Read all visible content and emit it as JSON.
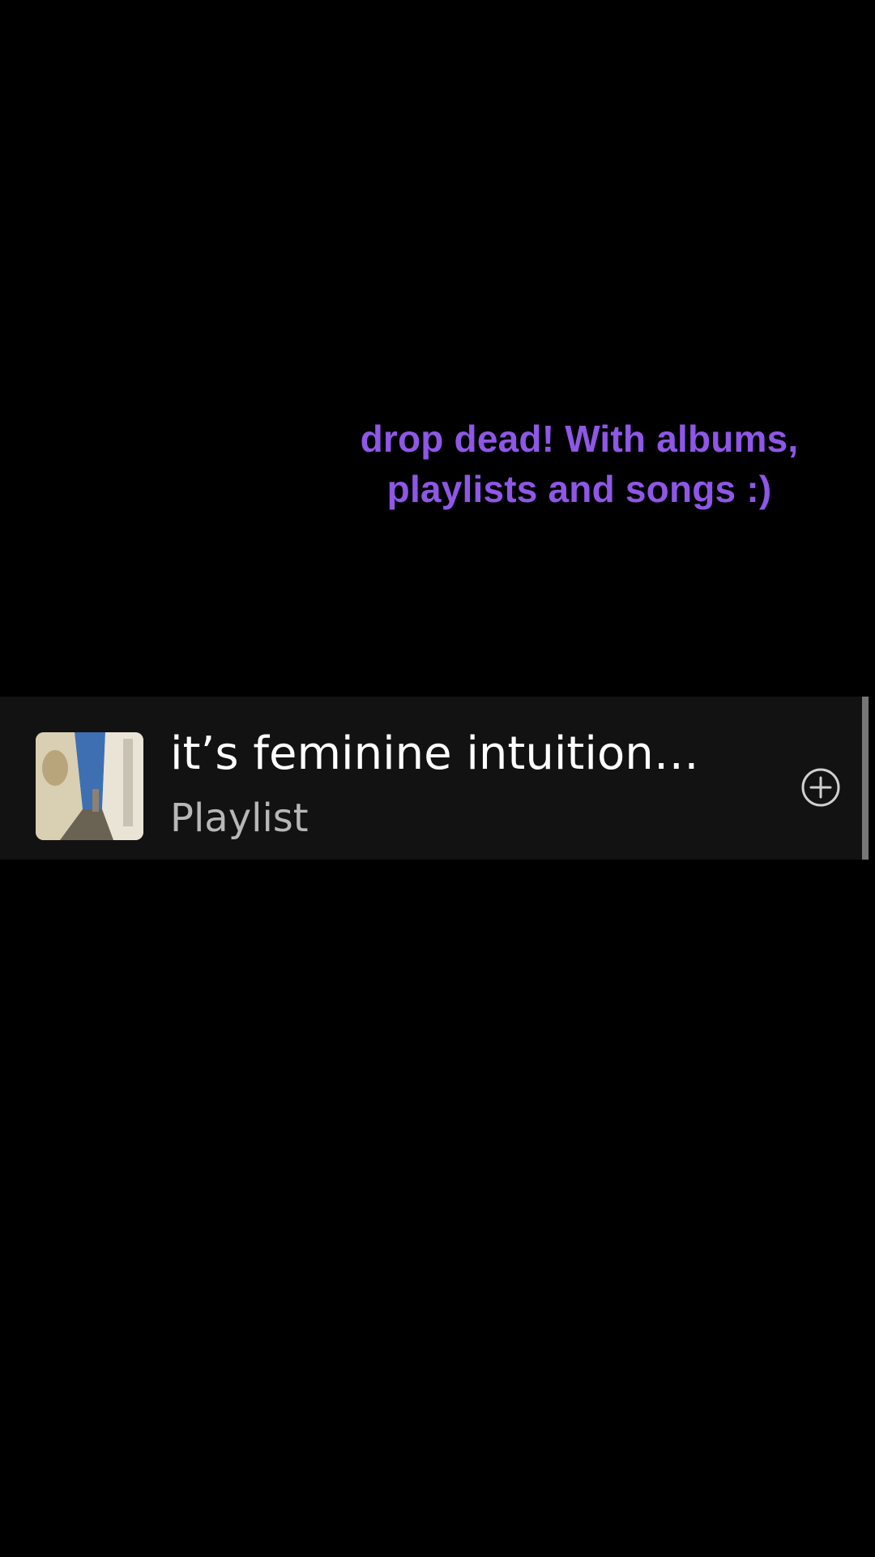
{
  "caption": {
    "line1": "drop dead! With albums,",
    "line2": "playlists and songs :)",
    "color": "#8e57e6"
  },
  "item": {
    "title": "it’s feminine intuition…",
    "subtitle": "Playlist",
    "thumbnail_icon": "album-cover-image",
    "action_icon": "add-circle-icon"
  },
  "colors": {
    "background": "#000000",
    "row_background": "#121212",
    "title_text": "#ffffff",
    "subtitle_text": "#b7b7b7"
  }
}
